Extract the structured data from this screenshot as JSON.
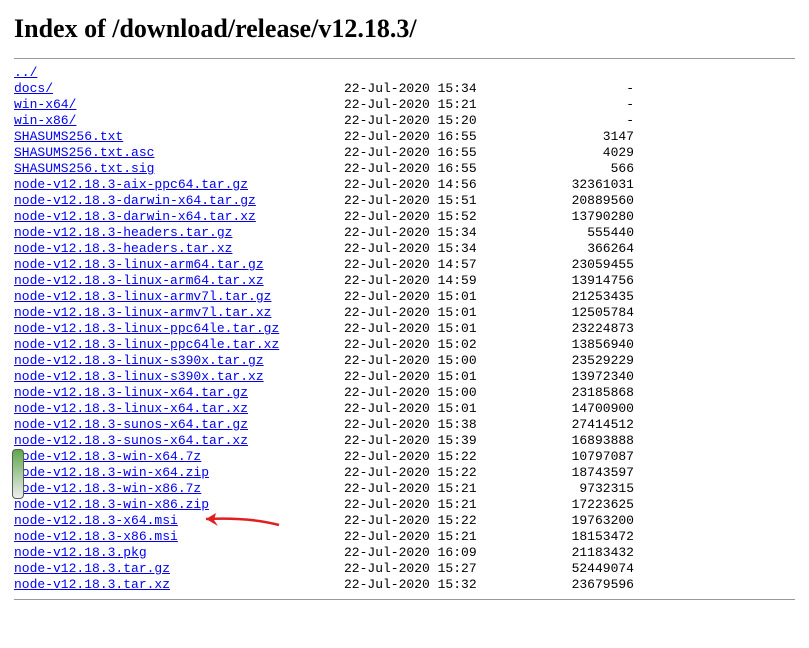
{
  "title": "Index of /download/release/v12.18.3/",
  "parent_link": "../",
  "files": [
    {
      "name": "docs/",
      "date": "22-Jul-2020 15:34",
      "size": "-"
    },
    {
      "name": "win-x64/",
      "date": "22-Jul-2020 15:21",
      "size": "-"
    },
    {
      "name": "win-x86/",
      "date": "22-Jul-2020 15:20",
      "size": "-"
    },
    {
      "name": "SHASUMS256.txt",
      "date": "22-Jul-2020 16:55",
      "size": "3147"
    },
    {
      "name": "SHASUMS256.txt.asc",
      "date": "22-Jul-2020 16:55",
      "size": "4029"
    },
    {
      "name": "SHASUMS256.txt.sig",
      "date": "22-Jul-2020 16:55",
      "size": "566"
    },
    {
      "name": "node-v12.18.3-aix-ppc64.tar.gz",
      "date": "22-Jul-2020 14:56",
      "size": "32361031"
    },
    {
      "name": "node-v12.18.3-darwin-x64.tar.gz",
      "date": "22-Jul-2020 15:51",
      "size": "20889560"
    },
    {
      "name": "node-v12.18.3-darwin-x64.tar.xz",
      "date": "22-Jul-2020 15:52",
      "size": "13790280"
    },
    {
      "name": "node-v12.18.3-headers.tar.gz",
      "date": "22-Jul-2020 15:34",
      "size": "555440"
    },
    {
      "name": "node-v12.18.3-headers.tar.xz",
      "date": "22-Jul-2020 15:34",
      "size": "366264"
    },
    {
      "name": "node-v12.18.3-linux-arm64.tar.gz",
      "date": "22-Jul-2020 14:57",
      "size": "23059455"
    },
    {
      "name": "node-v12.18.3-linux-arm64.tar.xz",
      "date": "22-Jul-2020 14:59",
      "size": "13914756"
    },
    {
      "name": "node-v12.18.3-linux-armv7l.tar.gz",
      "date": "22-Jul-2020 15:01",
      "size": "21253435"
    },
    {
      "name": "node-v12.18.3-linux-armv7l.tar.xz",
      "date": "22-Jul-2020 15:01",
      "size": "12505784"
    },
    {
      "name": "node-v12.18.3-linux-ppc64le.tar.gz",
      "date": "22-Jul-2020 15:01",
      "size": "23224873"
    },
    {
      "name": "node-v12.18.3-linux-ppc64le.tar.xz",
      "date": "22-Jul-2020 15:02",
      "size": "13856940"
    },
    {
      "name": "node-v12.18.3-linux-s390x.tar.gz",
      "date": "22-Jul-2020 15:00",
      "size": "23529229"
    },
    {
      "name": "node-v12.18.3-linux-s390x.tar.xz",
      "date": "22-Jul-2020 15:01",
      "size": "13972340"
    },
    {
      "name": "node-v12.18.3-linux-x64.tar.gz",
      "date": "22-Jul-2020 15:00",
      "size": "23185868"
    },
    {
      "name": "node-v12.18.3-linux-x64.tar.xz",
      "date": "22-Jul-2020 15:01",
      "size": "14700900"
    },
    {
      "name": "node-v12.18.3-sunos-x64.tar.gz",
      "date": "22-Jul-2020 15:38",
      "size": "27414512"
    },
    {
      "name": "node-v12.18.3-sunos-x64.tar.xz",
      "date": "22-Jul-2020 15:39",
      "size": "16893888"
    },
    {
      "name": "node-v12.18.3-win-x64.7z",
      "date": "22-Jul-2020 15:22",
      "size": "10797087"
    },
    {
      "name": "node-v12.18.3-win-x64.zip",
      "date": "22-Jul-2020 15:22",
      "size": "18743597"
    },
    {
      "name": "node-v12.18.3-win-x86.7z",
      "date": "22-Jul-2020 15:21",
      "size": "9732315"
    },
    {
      "name": "node-v12.18.3-win-x86.zip",
      "date": "22-Jul-2020 15:21",
      "size": "17223625"
    },
    {
      "name": "node-v12.18.3-x64.msi",
      "date": "22-Jul-2020 15:22",
      "size": "19763200"
    },
    {
      "name": "node-v12.18.3-x86.msi",
      "date": "22-Jul-2020 15:21",
      "size": "18153472"
    },
    {
      "name": "node-v12.18.3.pkg",
      "date": "22-Jul-2020 16:09",
      "size": "21183432"
    },
    {
      "name": "node-v12.18.3.tar.gz",
      "date": "22-Jul-2020 15:27",
      "size": "52449074"
    },
    {
      "name": "node-v12.18.3.tar.xz",
      "date": "22-Jul-2020 15:32",
      "size": "23679596"
    }
  ],
  "highlight_index": 27,
  "scroll_marker_index": 23
}
